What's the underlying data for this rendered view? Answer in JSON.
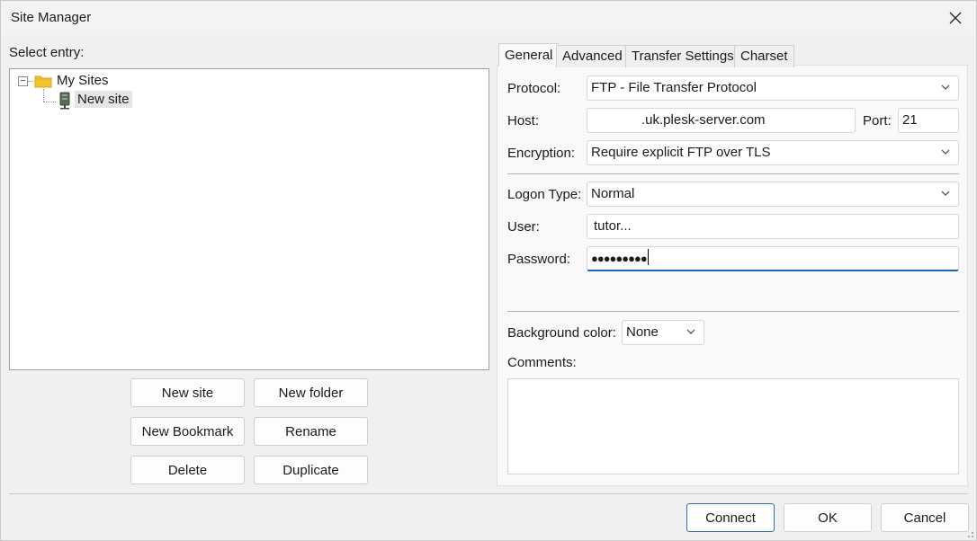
{
  "window": {
    "title": "Site Manager"
  },
  "left": {
    "select_entry_label": "Select entry:",
    "tree": {
      "root_label": "My Sites",
      "children": [
        {
          "label": "New site",
          "selected": true
        }
      ]
    },
    "buttons": {
      "new_site": "New site",
      "new_folder": "New folder",
      "new_bookmark": "New Bookmark",
      "rename": "Rename",
      "delete": "Delete",
      "duplicate": "Duplicate"
    }
  },
  "tabs": [
    {
      "label": "General",
      "active": true
    },
    {
      "label": "Advanced",
      "active": false
    },
    {
      "label": "Transfer Settings",
      "active": false
    },
    {
      "label": "Charset",
      "active": false
    }
  ],
  "general": {
    "protocol_label": "Protocol:",
    "protocol_value": "FTP - File Transfer Protocol",
    "host_label": "Host:",
    "host_value": ".uk.plesk-server.com",
    "port_label": "Port:",
    "port_value": "21",
    "encryption_label": "Encryption:",
    "encryption_value": "Require explicit FTP over TLS",
    "logon_type_label": "Logon Type:",
    "logon_type_value": "Normal",
    "user_label": "User:",
    "user_value": "tutor...",
    "password_label": "Password:",
    "password_value": "●●●●●●●●●",
    "background_color_label": "Background color:",
    "background_color_value": "None",
    "comments_label": "Comments:",
    "comments_value": ""
  },
  "footer": {
    "connect": "Connect",
    "ok": "OK",
    "cancel": "Cancel"
  },
  "colors": {
    "accent": "#1c63b8",
    "folder": "#f4c430"
  }
}
